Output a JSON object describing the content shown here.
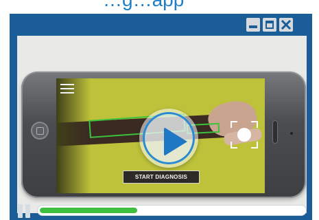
{
  "header": {
    "title": "…g…app"
  },
  "window": {
    "frame_color": "#1a5d97",
    "controls": {
      "minimize_icon": "minimize-icon",
      "maximize_icon": "maximize-icon",
      "close_icon": "close-icon"
    }
  },
  "video": {
    "start_diagnosis_label": "START DIAGNOSIS",
    "play_icon": "play-icon",
    "menu_icon": "hamburger-menu-icon",
    "shutter_icon": "camera-shutter-icon"
  },
  "player": {
    "pause_icon": "pause-icon",
    "progress_fraction": 0.37,
    "progress_color": "#3fbf3f"
  }
}
